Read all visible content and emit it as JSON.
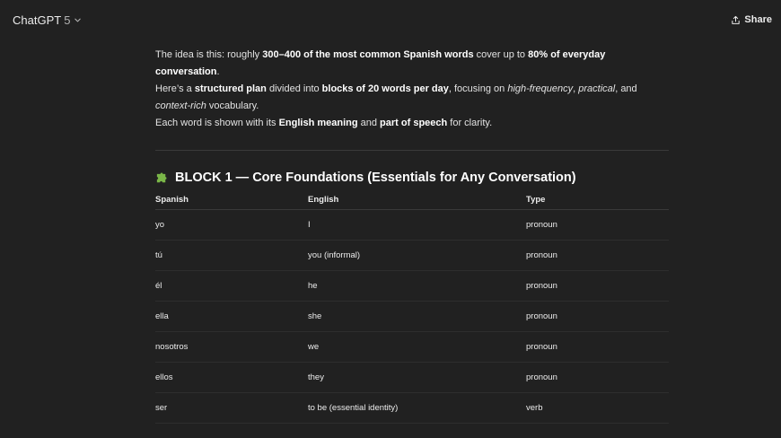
{
  "header": {
    "model_name": "ChatGPT",
    "model_version": "5",
    "share_label": "Share"
  },
  "message": {
    "para1": {
      "t1": "The idea is this: roughly ",
      "b1": "300–400 of the most common Spanish words",
      "t2": " cover up to ",
      "b2": "80% of everyday conversation",
      "t3": "."
    },
    "para2": {
      "t1": "Here’s a ",
      "b1": "structured plan",
      "t2": " divided into ",
      "b2": "blocks of 20 words per day",
      "t3": ", focusing on ",
      "i1": "high-frequency",
      "t4": ", ",
      "i2": "practical",
      "t5": ", and ",
      "i3": "context-rich",
      "t6": " vocabulary.",
      "line2_t1": "Each word is shown with its ",
      "line2_b1": "English meaning",
      "line2_t2": " and ",
      "line2_b2": "part of speech",
      "line2_t3": " for clarity."
    },
    "block1": {
      "icon": "puzzle-piece-icon",
      "title": "BLOCK 1 — Core Foundations (Essentials for Any Conversation)",
      "columns": [
        "Spanish",
        "English",
        "Type"
      ],
      "rows": [
        {
          "spanish": "yo",
          "english": "I",
          "type": "pronoun"
        },
        {
          "spanish": "tú",
          "english": "you (informal)",
          "type": "pronoun"
        },
        {
          "spanish": "él",
          "english": "he",
          "type": "pronoun"
        },
        {
          "spanish": "ella",
          "english": "she",
          "type": "pronoun"
        },
        {
          "spanish": "nosotros",
          "english": "we",
          "type": "pronoun"
        },
        {
          "spanish": "ellos",
          "english": "they",
          "type": "pronoun"
        },
        {
          "spanish": "ser",
          "english": "to be (essential identity)",
          "type": "verb"
        }
      ]
    }
  },
  "colors": {
    "background": "#212121",
    "text": "#ececec",
    "puzzle_icon": "#7ab648"
  }
}
